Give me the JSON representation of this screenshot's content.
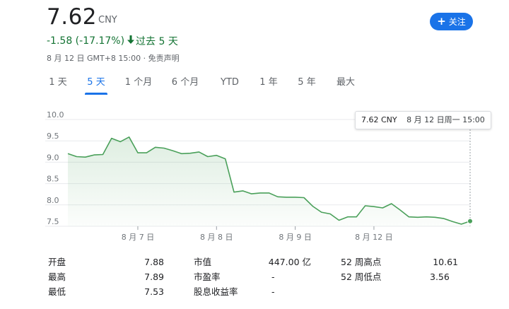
{
  "quote": {
    "price": "7.62",
    "currency": "CNY",
    "change": "-1.58 (-17.17%)",
    "period": "过去 5 天",
    "meta": "8 月 12 日 GMT+8 15:00 · 免责声明",
    "change_color": "#137333"
  },
  "follow_button": {
    "icon": "plus-icon",
    "label": "关注",
    "color": "#1a73e8"
  },
  "tabs": [
    {
      "label": "1 天",
      "active": false
    },
    {
      "label": "5 天",
      "active": true
    },
    {
      "label": "1 个月",
      "active": false
    },
    {
      "label": "6 个月",
      "active": false
    },
    {
      "label": "YTD",
      "active": false
    },
    {
      "label": "1 年",
      "active": false
    },
    {
      "label": "5 年",
      "active": false
    },
    {
      "label": "最大",
      "active": false
    }
  ],
  "tooltip": {
    "price": "7.62 CNY",
    "time": "8 月 12 日周一 15:00"
  },
  "chart_data": {
    "type": "area",
    "line_color": "#4aa05a",
    "ylim": [
      7.5,
      10.0
    ],
    "yticks": [
      "10.0",
      "9.5",
      "9.0",
      "8.5",
      "8.0",
      "7.5"
    ],
    "ytick_values": [
      10.0,
      9.5,
      9.0,
      8.5,
      8.0,
      7.5
    ],
    "xticks": [
      "8 月 7 日",
      "8 月 8 日",
      "8 月 9 日",
      "8 月 12 日"
    ],
    "xtick_index": [
      8,
      17,
      26,
      35
    ],
    "values": [
      9.2,
      9.13,
      9.12,
      9.17,
      9.18,
      9.56,
      9.48,
      9.59,
      9.22,
      9.22,
      9.35,
      9.33,
      9.27,
      9.2,
      9.21,
      9.24,
      9.13,
      9.16,
      9.08,
      8.3,
      8.33,
      8.26,
      8.28,
      8.28,
      8.19,
      8.18,
      8.18,
      8.17,
      7.97,
      7.83,
      7.79,
      7.64,
      7.72,
      7.72,
      7.98,
      7.96,
      7.93,
      8.03,
      7.88,
      7.72,
      7.71,
      7.72,
      7.71,
      7.68,
      7.61,
      7.55,
      7.62
    ]
  },
  "stats": {
    "col1": [
      {
        "label": "开盘",
        "value": "7.88"
      },
      {
        "label": "最高",
        "value": "7.89"
      },
      {
        "label": "最低",
        "value": "7.53"
      }
    ],
    "col2": [
      {
        "label": "市值",
        "value": "447.00 亿"
      },
      {
        "label": "市盈率",
        "value": "-"
      },
      {
        "label": "股息收益率",
        "value": "-"
      }
    ],
    "col3": [
      {
        "label": "52 周高点",
        "value": "10.61"
      },
      {
        "label": "52 周低点",
        "value": "3.56"
      }
    ]
  }
}
